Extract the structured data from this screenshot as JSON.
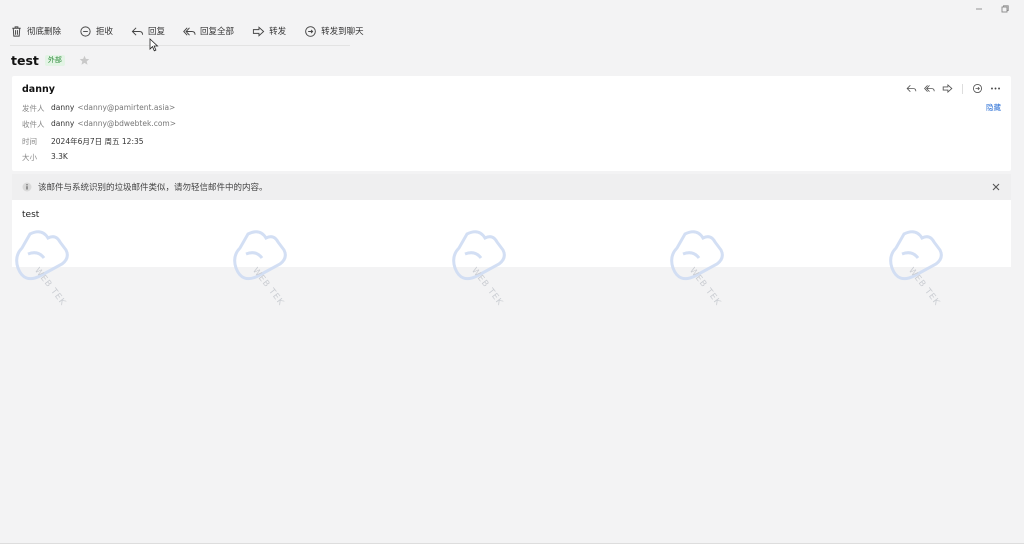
{
  "window": {
    "minimize_icon": "minimize-icon",
    "restore_icon": "restore-icon"
  },
  "toolbar": {
    "delete_label": "彻底删除",
    "reject_label": "拒收",
    "reply_label": "回复",
    "reply_all_label": "回复全部",
    "forward_label": "转发",
    "forward_chat_label": "转发到聊天"
  },
  "mail": {
    "subject": "test",
    "badge": "外部",
    "sender_name": "danny",
    "from_label": "发件人",
    "from_name": "danny",
    "from_addr": "<danny@pamirtent.asia>",
    "to_label": "收件人",
    "to_name": "danny",
    "to_addr": "<danny@bdwebtek.com>",
    "time_label": "时间",
    "time_value": "2024年6月7日 周五 12:35",
    "size_label": "大小",
    "size_value": "3.3K",
    "hide_label": "隐藏",
    "warning": "该邮件与系统识别的垃圾邮件类似，请勿轻信邮件中的内容。",
    "body": "test"
  },
  "watermark": {
    "text": "WEB TEK"
  },
  "colors": {
    "accent": "#2a6fd6",
    "badge_fg": "#2e8b3a",
    "badge_bg": "#e3f4e5",
    "background": "#f3f3f4"
  }
}
